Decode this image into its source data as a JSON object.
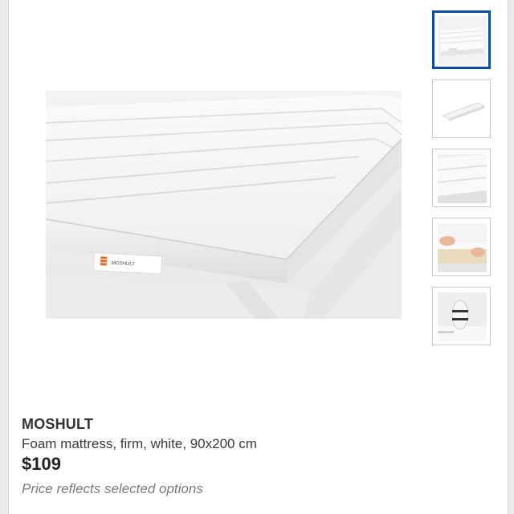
{
  "product": {
    "name": "MOSHULT",
    "description": "Foam mattress, firm, white, 90x200 cm",
    "price": "$109",
    "price_note": "Price reflects selected options",
    "label_text": "MOSHULT"
  },
  "gallery": {
    "main_image": "mattress-corner-photo",
    "thumbnails": [
      {
        "name": "mattress-corner-thumbnail",
        "selected": true
      },
      {
        "name": "mattress-full-thumbnail",
        "selected": false
      },
      {
        "name": "mattress-fabric-closeup-thumbnail",
        "selected": false
      },
      {
        "name": "mattress-zipper-cover-thumbnail",
        "selected": false
      },
      {
        "name": "mattress-rolled-package-thumbnail",
        "selected": false
      }
    ]
  },
  "colors": {
    "selected_border": "#0b4fa0",
    "thumb_border": "#c9c9c9",
    "price_note": "#7a7a7a"
  }
}
